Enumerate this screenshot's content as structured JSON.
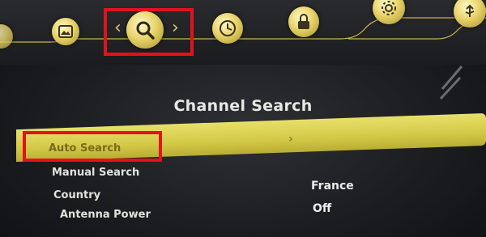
{
  "menu_tabs": [
    {
      "icon": "picture-icon"
    },
    {
      "icon": "search-icon",
      "selected": true,
      "left_arrow": "‹",
      "right_arrow": "›"
    },
    {
      "icon": "clock-icon"
    },
    {
      "icon": "lock-icon"
    },
    {
      "icon": "settings-icon"
    },
    {
      "icon": "usb-icon"
    }
  ],
  "page": {
    "title": "Channel Search"
  },
  "menu": {
    "items": [
      {
        "label": "Auto Search",
        "value": "›",
        "selected": true
      },
      {
        "label": "Manual Search",
        "value": ""
      },
      {
        "label": "Country",
        "value": "France"
      },
      {
        "label": "Antenna Power",
        "value": "Off"
      }
    ]
  },
  "colors": {
    "highlight": "#d8cf55",
    "focus": "#e3121b",
    "icon": "#e8d36a"
  }
}
